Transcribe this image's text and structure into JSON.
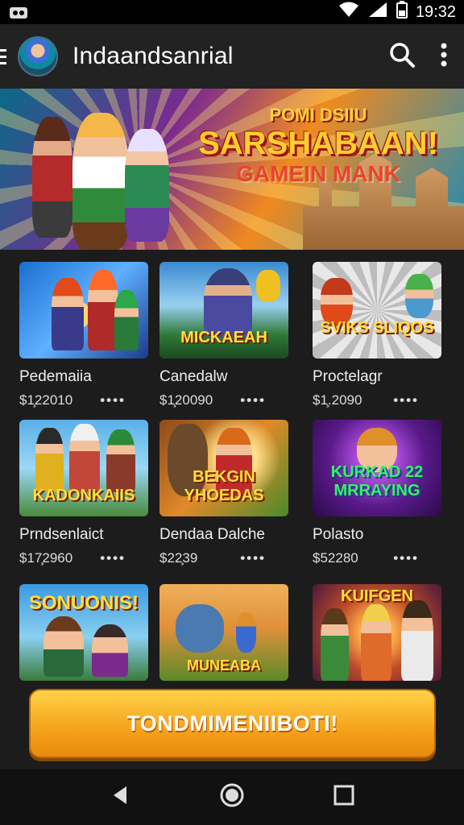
{
  "status_bar": {
    "time": "19:32"
  },
  "app_bar": {
    "title": "Indaandsanrial"
  },
  "banner": {
    "line1": "POMI DSIIU",
    "line2": "SARSHABAAN!",
    "line3": "GAMEIN MANK"
  },
  "games": [
    {
      "name": "Pedemaiia",
      "price": "$1̧22010",
      "art_text": ""
    },
    {
      "name": "Canedalw",
      "price": "$1̧20090",
      "art_text": "MICKAEAH"
    },
    {
      "name": "Proctelagr",
      "price": "$1̧.2090",
      "art_text": "SVIKS SLIQOS"
    },
    {
      "name": "Prndsenlaict",
      "price": "$17̧2960",
      "art_text": "KADONKAIIS"
    },
    {
      "name": "Dendaa Dalche",
      "price": "$22̧39",
      "art_text": "BEKGIN YHOEDAS"
    },
    {
      "name": "Polasto",
      "price": "$52280",
      "art_text": "KURKAD 22 MRRAYING"
    },
    {
      "name": "",
      "price": "",
      "art_text": "SONUONIS!"
    },
    {
      "name": "",
      "price": "",
      "art_text": "MUNEABA"
    },
    {
      "name": "",
      "price": "",
      "art_text": "KUIFGEN"
    }
  ],
  "more_glyph": "••••",
  "cta": {
    "label": "TONDMIMENIIBOTI!"
  },
  "icons": {
    "search": "search-icon",
    "more": "more-vert-icon",
    "back": "back-icon",
    "home": "home-icon",
    "recents": "recents-icon"
  }
}
